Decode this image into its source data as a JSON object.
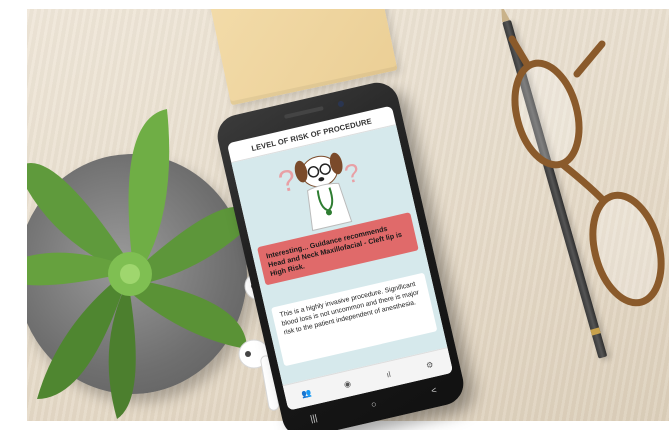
{
  "screen": {
    "title": "LEVEL OF RISK OF PROCEDURE",
    "alert_text": "Interesting... Guidance recommends Head and Neck Maxillofacial - Cleft lip is High Risk.",
    "description": "This is a highly invasive procedure. Significant blood loss is not uncommon and there is major risk to the patient independent of anesthesia."
  },
  "tabs": [
    {
      "icon": "people-icon",
      "glyph": "👥"
    },
    {
      "icon": "user-icon",
      "glyph": "◉"
    },
    {
      "icon": "bar-chart-icon",
      "glyph": "ıl"
    },
    {
      "icon": "gear-icon",
      "glyph": "⚙"
    }
  ],
  "android_nav": [
    {
      "icon": "recents-icon",
      "glyph": "|||"
    },
    {
      "icon": "home-icon",
      "glyph": "○"
    },
    {
      "icon": "back-icon",
      "glyph": "<"
    }
  ],
  "colors": {
    "alert_bg": "#e06a6a",
    "screen_bg": "#d6e9ec",
    "desk": "#e9dfcf"
  }
}
